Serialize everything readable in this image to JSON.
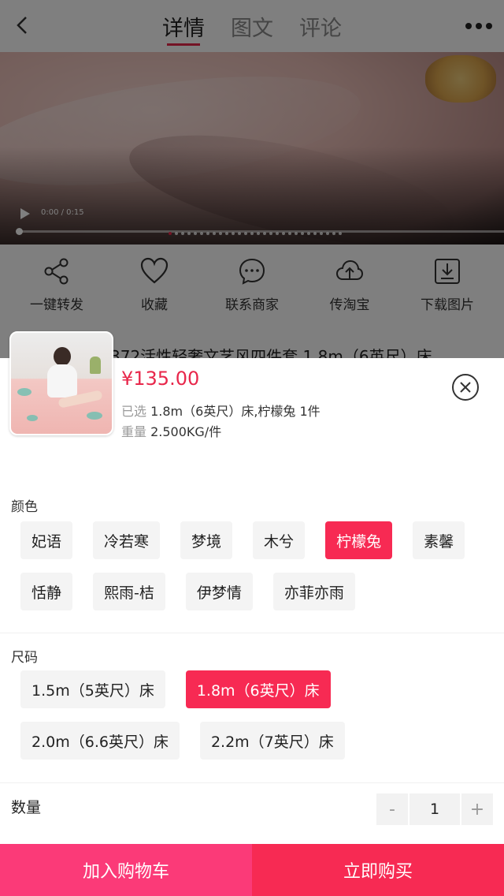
{
  "nav": {
    "tabs": [
      {
        "label": "详情",
        "active": true
      },
      {
        "label": "图文",
        "active": false
      },
      {
        "label": "评论",
        "active": false
      }
    ]
  },
  "video": {
    "time": "0:00 / 0:15",
    "progress": 0
  },
  "actions": [
    {
      "label": "一键转发",
      "icon": "share-icon"
    },
    {
      "label": "收藏",
      "icon": "heart-icon"
    },
    {
      "label": "联系商家",
      "icon": "chat-icon"
    },
    {
      "label": "传淘宝",
      "icon": "cloud-upload-icon"
    },
    {
      "label": "下载图片",
      "icon": "download-icon"
    }
  ],
  "product": {
    "title_partial": "372活性轻奢文艺风四件套 1.8m（6英尺）床",
    "price": "¥135.00",
    "selected_label": "已选",
    "selected_value": "1.8m（6英尺）床,柠檬兔 1件",
    "weight_label": "重量",
    "weight_value": "2.500KG/件"
  },
  "color_section": {
    "title": "颜色",
    "options": [
      "妃语",
      "冷若寒",
      "梦境",
      "木兮",
      "柠檬兔",
      "素馨",
      "恬静",
      "熙雨-桔",
      "伊梦情",
      "亦菲亦雨"
    ],
    "selected": "柠檬兔"
  },
  "size_section": {
    "title": "尺码",
    "options": [
      "1.5m（5英尺）床",
      "1.8m（6英尺）床",
      "2.0m（6.6英尺）床",
      "2.2m（7英尺）床"
    ],
    "selected": "1.8m（6英尺）床"
  },
  "quantity": {
    "label": "数量",
    "minus": "-",
    "value": "1",
    "plus": "+"
  },
  "bottom": {
    "cart": "加入购物车",
    "buy": "立即购买"
  },
  "colors": {
    "accent": "#f72a53",
    "cart": "#fb3a78",
    "chip_bg": "#f4f4f4"
  }
}
